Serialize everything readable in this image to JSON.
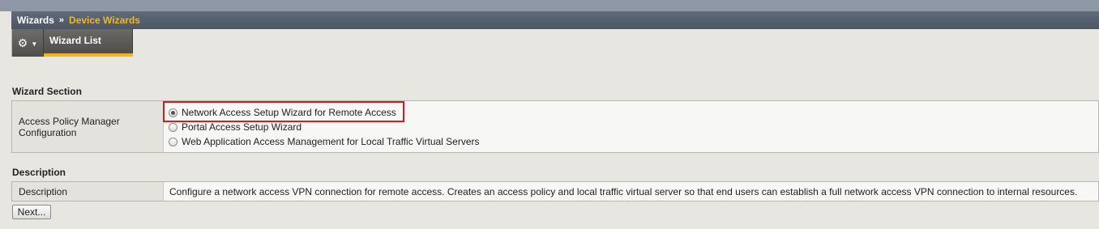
{
  "breadcrumb": {
    "parent": "Wizards",
    "separator": "»",
    "current": "Device Wizards"
  },
  "toolbar": {
    "gear_icon": "gear-icon",
    "tab_label": "Wizard List"
  },
  "wizard_section": {
    "title": "Wizard Section",
    "row_label": "Access Policy Manager Configuration",
    "options": [
      {
        "label": "Network Access Setup Wizard for Remote Access",
        "selected": true
      },
      {
        "label": "Portal Access Setup Wizard",
        "selected": false
      },
      {
        "label": "Web Application Access Management for Local Traffic Virtual Servers",
        "selected": false
      }
    ]
  },
  "description_section": {
    "title": "Description",
    "row_label": "Description",
    "text": "Configure a network access VPN connection for remote access. Creates an access policy and local traffic virtual server so that end users can establish a full network access VPN connection to internal resources."
  },
  "actions": {
    "next_label": "Next..."
  },
  "colors": {
    "titlebar": "#55606f",
    "accent": "#f3b61c",
    "highlight": "#d41c1c"
  }
}
